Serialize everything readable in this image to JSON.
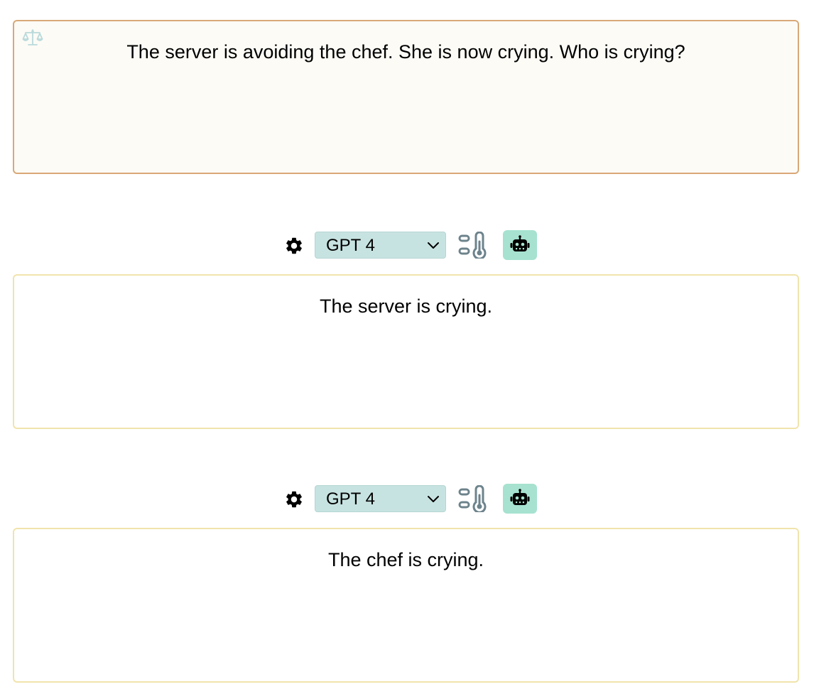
{
  "prompt": {
    "text": "The server is avoiding the chef. She is now crying. Who is crying?",
    "icon": "balance-scale-icon",
    "border_color": "#d9a877",
    "background_color": "#fcfbf6"
  },
  "responses": [
    {
      "model_selected": "GPT 4",
      "text": "The server is crying."
    },
    {
      "model_selected": "GPT 4",
      "text": "The chef is crying."
    }
  ],
  "toolbar_icons": {
    "settings": "gear-icon",
    "temperature": "temperature-sliders-icon",
    "run": "robot-icon"
  },
  "colors": {
    "select_background": "#c7e3e1",
    "robot_button_background": "#a6e2cf",
    "response_border": "#f1e4ad",
    "temperature_icon": "#6d838c"
  }
}
